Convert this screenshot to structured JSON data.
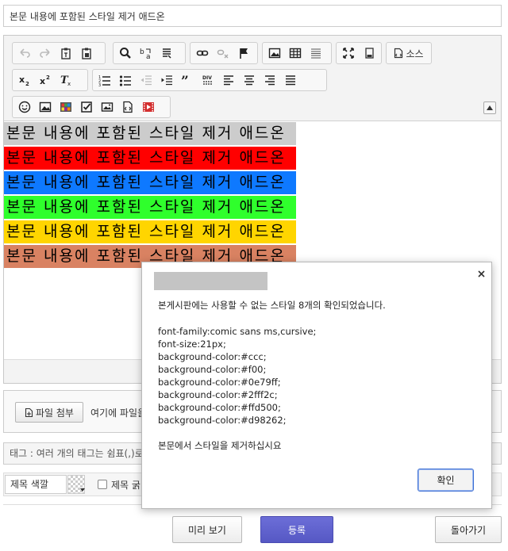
{
  "title_input": {
    "value": "본문 내용에 포함된 스타일 제거 애드온"
  },
  "toolbar": {
    "row1": [
      "undo-icon",
      "redo-icon",
      "paste-text-icon",
      "paste-word-icon",
      "find-icon",
      "replace-icon",
      "select-all-icon",
      "link-icon",
      "unlink-icon",
      "anchor-icon",
      "image-icon",
      "table-icon",
      "horizontal-rule-icon",
      "maximize-icon",
      "show-blocks-icon",
      "source-icon"
    ],
    "source_label": "소스",
    "row2": [
      "subscript-icon",
      "superscript-icon",
      "remove-format-icon",
      "numbered-list-icon",
      "bulleted-list-icon",
      "outdent-icon",
      "indent-icon",
      "blockquote-icon",
      "div-icon",
      "align-left-icon",
      "align-center-icon",
      "align-right-icon",
      "justify-icon"
    ],
    "row3": [
      "emoticon-icon",
      "image-upload-icon",
      "color-palette-icon",
      "checkbox-icon",
      "media-icon",
      "code-icon",
      "video-icon"
    ]
  },
  "editor": {
    "lines": [
      {
        "text": "본문 내용에 포함된 스타일 제거 애드온",
        "bg": "#cccccc"
      },
      {
        "text": "본문 내용에 포함된 스타일 제거 애드온",
        "bg": "#ff0000"
      },
      {
        "text": "본문 내용에 포함된 스타일 제거 애드온",
        "bg": "#0e79ff"
      },
      {
        "text": "본문 내용에 포함된 스타일 제거 애드온",
        "bg": "#2fff2c"
      },
      {
        "text": "본문 내용에 포함된 스타일 제거 애드온",
        "bg": "#ffd500"
      },
      {
        "text": "본문 내용에 포함된 스타일 제거 애드온",
        "bg": "#d98262"
      }
    ]
  },
  "attach": {
    "button_label": "파일 첨부",
    "hint": "여기에 파일을"
  },
  "tags": {
    "placeholder": "태그 : 여러 개의 태그는 쉼표(,)로 구"
  },
  "title_color": {
    "label": "제목 색깔",
    "bold_label": "제목 굵"
  },
  "buttons": {
    "preview": "미리 보기",
    "submit": "등록",
    "back": "돌아가기"
  },
  "dialog": {
    "intro": "본게시판에는 사용할 수 없는 스타일 8개의 확인되었습니다.",
    "styles": [
      "font-family:comic sans ms,cursive;",
      "font-size:21px;",
      "background-color:#ccc;",
      "background-color:#f00;",
      "background-color:#0e79ff;",
      "background-color:#2fff2c;",
      "background-color:#ffd500;",
      "background-color:#d98262;"
    ],
    "outro": "본문에서 스타일을 제거하십시요",
    "ok": "확인"
  },
  "colors": {
    "submit_bg": "#5658c4",
    "dialog_ok_border": "#3d6fd3"
  }
}
